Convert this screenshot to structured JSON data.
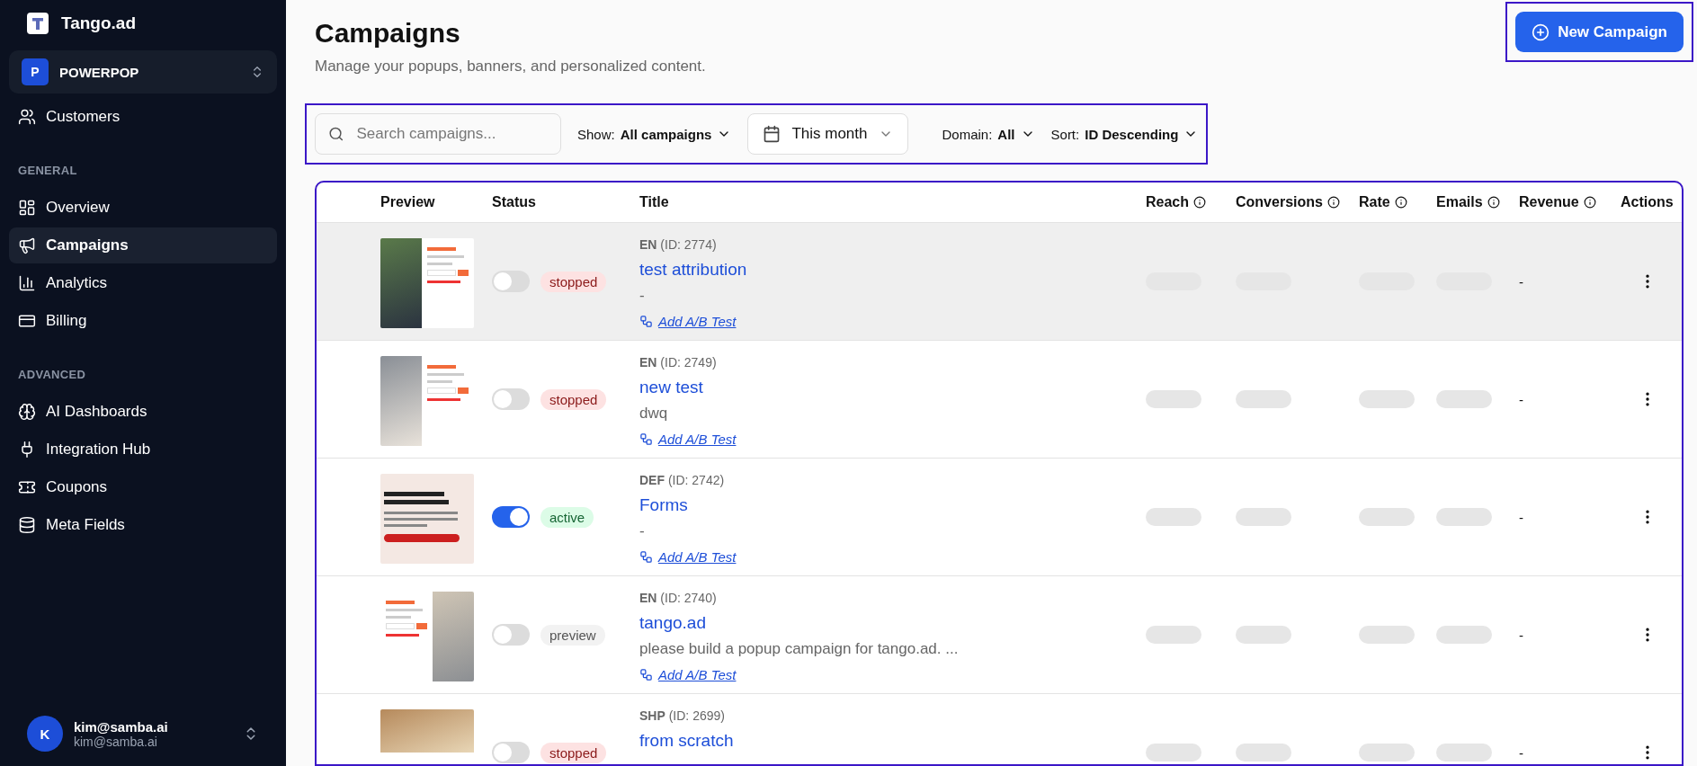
{
  "sidebar": {
    "brand": "Tango.ad",
    "workspace": {
      "initial": "P",
      "name": "POWERPOP"
    },
    "sections": [
      {
        "items": [
          {
            "label": "Customers",
            "selected": false
          }
        ]
      },
      {
        "heading": "GENERAL",
        "items": [
          {
            "label": "Overview",
            "selected": false
          },
          {
            "label": "Campaigns",
            "selected": true
          },
          {
            "label": "Analytics",
            "selected": false
          },
          {
            "label": "Billing",
            "selected": false
          }
        ]
      },
      {
        "heading": "ADVANCED",
        "items": [
          {
            "label": "AI Dashboards",
            "selected": false
          },
          {
            "label": "Integration Hub",
            "selected": false
          },
          {
            "label": "Coupons",
            "selected": false
          },
          {
            "label": "Meta Fields",
            "selected": false
          }
        ]
      }
    ],
    "user": {
      "initial": "K",
      "name": "kim@samba.ai",
      "email": "kim@samba.ai"
    }
  },
  "page": {
    "title": "Campaigns",
    "subtitle": "Manage your popups, banners, and personalized content.",
    "new_button": {
      "label": "New Campaign",
      "outlined": true
    }
  },
  "filters": {
    "outlined": true,
    "search": {
      "placeholder": "Search campaigns..."
    },
    "show": {
      "label": "Show:",
      "value": "All campaigns"
    },
    "date": {
      "value": "This month"
    },
    "domain": {
      "label": "Domain:",
      "value": "All"
    },
    "sort": {
      "label": "Sort:",
      "value": "ID Descending"
    }
  },
  "table": {
    "outlined": true,
    "columns": [
      {
        "label": "Preview"
      },
      {
        "label": "Status"
      },
      {
        "label": "Title"
      },
      {
        "label": "Reach",
        "info": true
      },
      {
        "label": "Conversions",
        "info": true
      },
      {
        "label": "Rate",
        "info": true
      },
      {
        "label": "Emails",
        "info": true
      },
      {
        "label": "Revenue",
        "info": true
      },
      {
        "label": "Actions"
      }
    ],
    "rows": [
      {
        "hovered": true,
        "on": false,
        "status": "stopped",
        "lang": "EN",
        "id": "(ID: 2774)",
        "title": "test attribution",
        "description": "-",
        "ab_link": "Add A/B Test",
        "loading": true,
        "revenue": "-"
      },
      {
        "hovered": false,
        "on": false,
        "status": "stopped",
        "lang": "EN",
        "id": "(ID: 2749)",
        "title": "new test",
        "description": "dwq",
        "ab_link": "Add A/B Test",
        "loading": true,
        "revenue": "-"
      },
      {
        "hovered": false,
        "on": true,
        "status": "active",
        "lang": "DEF",
        "id": "(ID: 2742)",
        "title": "Forms",
        "description": "-",
        "ab_link": "Add A/B Test",
        "loading": true,
        "revenue": "-"
      },
      {
        "hovered": false,
        "on": false,
        "status": "preview",
        "lang": "EN",
        "id": "(ID: 2740)",
        "title": "tango.ad",
        "description": "please build a popup campaign for tango.ad. ...",
        "ab_link": "Add A/B Test",
        "loading": true,
        "revenue": "-"
      },
      {
        "hovered": false,
        "on": false,
        "status": "stopped",
        "lang": "SHP",
        "id": "(ID: 2699)",
        "title": "from scratch",
        "loading": true,
        "revenue": "-"
      }
    ]
  }
}
